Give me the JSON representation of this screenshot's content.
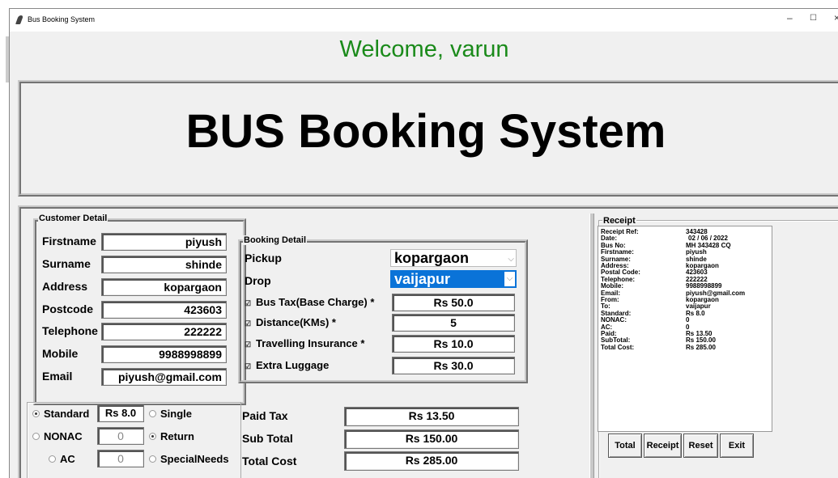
{
  "window": {
    "title": "Bus Booking System",
    "controls": [
      "–",
      "☐",
      "×"
    ]
  },
  "welcome": "Welcome, varun",
  "banner_title": "BUS Booking System",
  "customer": {
    "legend": "Customer Detail",
    "fields": [
      {
        "label": "Firstname",
        "value": "piyush"
      },
      {
        "label": "Surname",
        "value": "shinde"
      },
      {
        "label": "Address",
        "value": "kopargaon"
      },
      {
        "label": "Postcode",
        "value": "423603"
      },
      {
        "label": "Telephone",
        "value": "222222"
      },
      {
        "label": "Mobile",
        "value": "9988998899"
      },
      {
        "label": "Email",
        "value": "piyush@gmail.com"
      }
    ]
  },
  "booking": {
    "legend": "Booking Detail",
    "pickup_label": "Pickup",
    "pickup_value": "kopargaon",
    "drop_label": "Drop",
    "drop_value": "vaijapur",
    "checks": [
      {
        "label": "Bus Tax(Base Charge) *",
        "value": "Rs 50.0"
      },
      {
        "label": "Distance(KMs) *",
        "value": "5"
      },
      {
        "label": "Travelling Insurance *",
        "value": "Rs 10.0"
      },
      {
        "label": "Extra Luggage",
        "value": "Rs 30.0"
      }
    ]
  },
  "class_options": {
    "standard": {
      "label": "Standard",
      "value": "Rs 8.0",
      "selected": true
    },
    "nonac": {
      "label": "NONAC",
      "value": "0",
      "selected": false
    },
    "ac": {
      "label": "AC",
      "value": "0",
      "selected": false
    }
  },
  "trip_options": {
    "single": {
      "label": "Single",
      "selected": false
    },
    "return": {
      "label": "Return",
      "selected": true
    },
    "special": {
      "label": "SpecialNeeds",
      "selected": false
    }
  },
  "totals": {
    "paid_tax_label": "Paid Tax",
    "paid_tax": "Rs 13.50",
    "sub_total_label": "Sub Total",
    "sub_total": "Rs 150.00",
    "total_cost_label": "Total Cost",
    "total_cost": "Rs 285.00"
  },
  "receipt": {
    "legend": "Receipt",
    "rows": [
      {
        "k": "Receipt Ref:",
        "v": "343428"
      },
      {
        "k": "Date:",
        "v": "02 / 06 / 2022"
      },
      {
        "k": "Bus No:",
        "v": "MH 343428 CQ"
      },
      {
        "k": "Firstname:",
        "v": "piyush"
      },
      {
        "k": "Surname:",
        "v": "shinde"
      },
      {
        "k": "Address:",
        "v": "kopargaon"
      },
      {
        "k": "Postal Code:",
        "v": "423603"
      },
      {
        "k": "Telephone:",
        "v": "222222"
      },
      {
        "k": "Mobile:",
        "v": "9988998899"
      },
      {
        "k": "Email:",
        "v": "piyush@gmail.com"
      },
      {
        "k": "From:",
        "v": "kopargaon"
      },
      {
        "k": "To:",
        "v": "vaijapur"
      },
      {
        "k": "Standard:",
        "v": "Rs 8.0"
      },
      {
        "k": "NONAC:",
        "v": "0"
      },
      {
        "k": "AC:",
        "v": "0"
      },
      {
        "k": "Paid:",
        "v": "Rs 13.50"
      },
      {
        "k": "SubTotal:",
        "v": "Rs 150.00"
      },
      {
        "k": "Total Cost:",
        "v": "Rs 285.00"
      }
    ]
  },
  "buttons": {
    "total": "Total",
    "receipt": "Receipt",
    "reset": "Reset",
    "exit": "Exit"
  },
  "colors": {
    "welcome": "#1a8a1a",
    "selection": "#0a73d8"
  }
}
